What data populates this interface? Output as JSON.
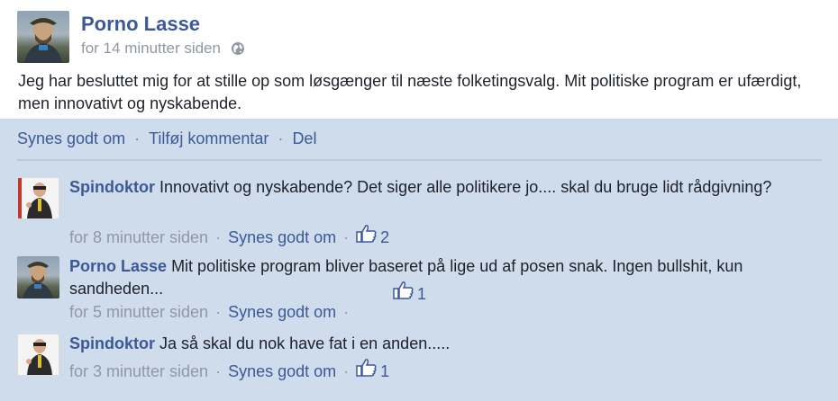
{
  "post": {
    "author": "Porno Lasse",
    "time": "for 14 minutter siden",
    "text": "Jeg har besluttet mig for at stille op som løsgænger til næste folketingsvalg. Mit politiske program er ufærdigt, men innovativt og nyskabende."
  },
  "actions": {
    "like": "Synes godt om",
    "comment": "Tilføj kommentar",
    "share": "Del",
    "separator": "·"
  },
  "comments": [
    {
      "author": "Spindoktor",
      "text": "Innovativt og nyskabende? Det siger alle politikere jo.... skal du bruge lidt rådgivning?",
      "time": "for 8 minutter siden",
      "like_label": "Synes godt om",
      "likes": "2"
    },
    {
      "author": "Porno Lasse",
      "text": "Mit politiske program bliver baseret på lige ud af posen snak. Ingen bullshit, kun sandheden...",
      "time": "for 5 minutter siden",
      "like_label": "Synes godt om",
      "likes": "1"
    },
    {
      "author": "Spindoktor",
      "text": "Ja så skal du nok have fat i en anden.....",
      "time": "for 3 minutter siden",
      "like_label": "Synes godt om",
      "likes": "1"
    }
  ],
  "colors": {
    "link": "#3b5998",
    "muted": "#9197a3",
    "comment_bg": "#cfdcec"
  },
  "icons": {
    "privacy": "globe-icon",
    "like": "thumbs-up-icon"
  }
}
